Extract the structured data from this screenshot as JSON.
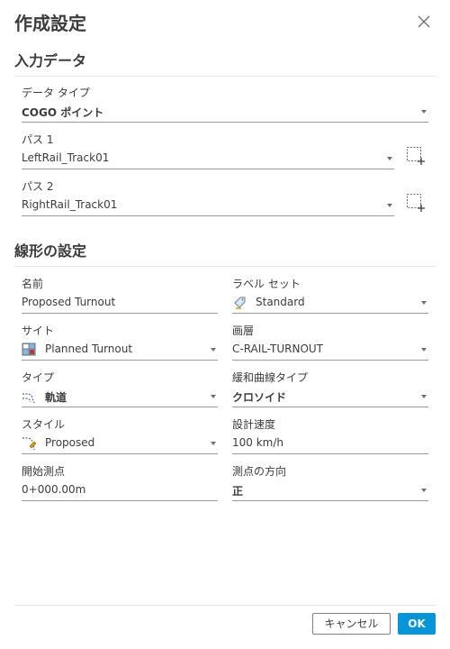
{
  "dialog": {
    "title": "作成設定",
    "close_icon": "close-icon"
  },
  "input_section": {
    "title": "入力データ",
    "data_type": {
      "label": "データ タイプ",
      "value": "COGO ポイント"
    },
    "path1": {
      "label": "パス 1",
      "value": "LeftRail_Track01",
      "pick_icon": "select-in-drawing-icon"
    },
    "path2": {
      "label": "パス 2",
      "value": "RightRail_Track01",
      "pick_icon": "select-in-drawing-icon"
    }
  },
  "alignment_section": {
    "title": "線形の設定",
    "name": {
      "label": "名前",
      "value": "Proposed Turnout"
    },
    "label_set": {
      "label": "ラベル セット",
      "value": "Standard",
      "icon": "label-set-icon"
    },
    "site": {
      "label": "サイト",
      "value": "Planned Turnout",
      "icon": "site-icon"
    },
    "layer": {
      "label": "画層",
      "value": "C-RAIL-TURNOUT"
    },
    "type": {
      "label": "タイプ",
      "value": "軌道",
      "icon": "alignment-type-icon"
    },
    "spiral_type": {
      "label": "緩和曲線タイプ",
      "value": "クロソイド"
    },
    "style": {
      "label": "スタイル",
      "value": "Proposed",
      "icon": "alignment-style-icon"
    },
    "design_speed": {
      "label": "設計速度",
      "value": "100 km/h"
    },
    "start_station": {
      "label": "開始測点",
      "value": "0+000.00m"
    },
    "station_direction": {
      "label": "測点の方向",
      "value": "正"
    }
  },
  "footer": {
    "cancel_label": "キャンセル",
    "ok_label": "OK"
  },
  "colors": {
    "accent": "#0696d7",
    "divider": "#e6e6e6",
    "text": "#3c3c3c"
  }
}
